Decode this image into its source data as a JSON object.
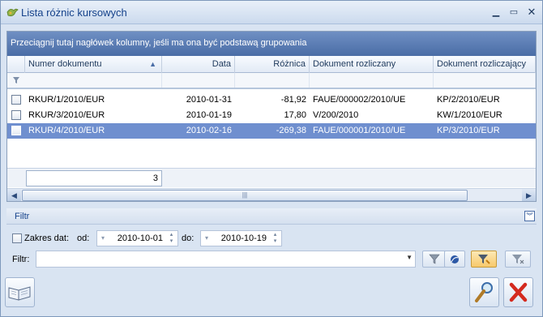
{
  "window": {
    "title": "Lista różnic kursowych"
  },
  "grid": {
    "group_hint": "Przeciągnij tutaj nagłówek kolumny, jeśli ma ona być podstawą grupowania",
    "columns": [
      "Numer dokumentu",
      "Data",
      "Różnica",
      "Dokument rozliczany",
      "Dokument rozliczający"
    ],
    "sort_indicator": "▲",
    "rows": [
      {
        "numer": "RKUR/1/2010/EUR",
        "data": "2010-01-31",
        "roznica": "-81,92",
        "rozliczany": "FAUE/000002/2010/UE",
        "rozliczajacy": "KP/2/2010/EUR"
      },
      {
        "numer": "RKUR/3/2010/EUR",
        "data": "2010-01-19",
        "roznica": "17,80",
        "rozliczany": "V/200/2010",
        "rozliczajacy": "KW/1/2010/EUR"
      },
      {
        "numer": "RKUR/4/2010/EUR",
        "data": "2010-02-16",
        "roznica": "-269,38",
        "rozliczany": "FAUE/000001/2010/UE",
        "rozliczajacy": "KP/3/2010/EUR"
      }
    ],
    "selected_row": 2,
    "count": "3"
  },
  "filter": {
    "title": "Filtr",
    "zakres_label": "Zakres dat:",
    "od_label": "od:",
    "od_value": "2010-10-01",
    "do_label": "do:",
    "do_value": "2010-10-19",
    "filtr_label": "Filtr:",
    "filtr_value": ""
  },
  "colors": {
    "group_panel": "#5a7cb5",
    "selected_row": "#6f8fcf",
    "close_red": "#d42a1f"
  },
  "icons": [
    "app-icon",
    "minimize-icon",
    "maximize-icon",
    "close-icon",
    "funnel-icon",
    "book-icon",
    "magnifier-icon",
    "cancel-x-icon"
  ]
}
